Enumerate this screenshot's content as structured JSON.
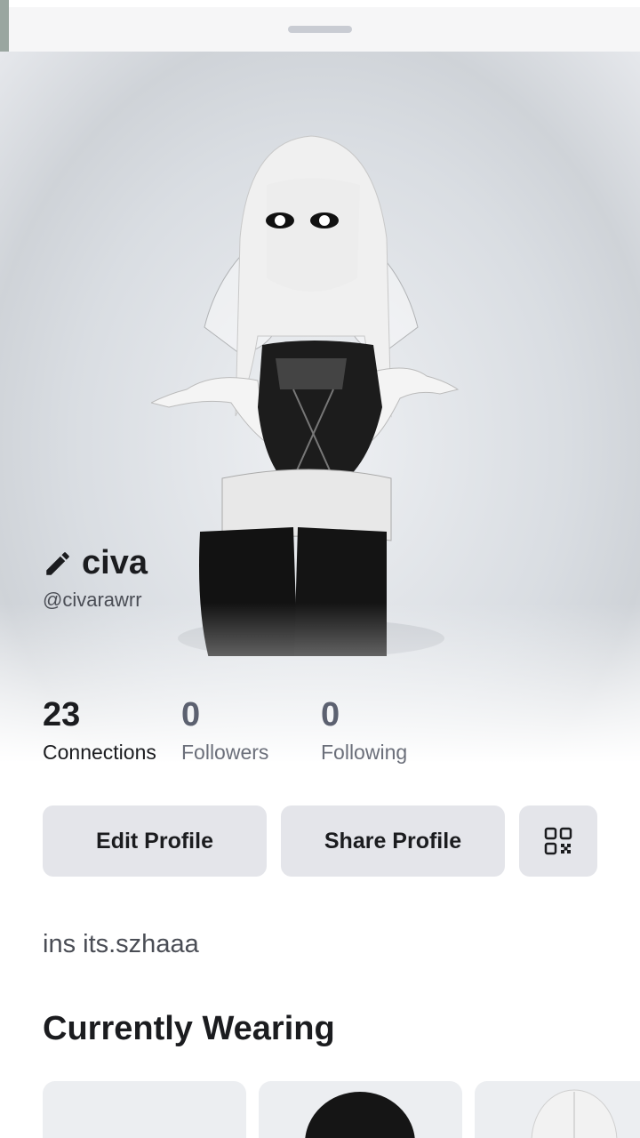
{
  "profile": {
    "display_name": "civa",
    "username": "@civarawrr",
    "bio": "ins its.szhaaa"
  },
  "stats": [
    {
      "value": "23",
      "label": "Connections"
    },
    {
      "value": "0",
      "label": "Followers"
    },
    {
      "value": "0",
      "label": "Following"
    }
  ],
  "actions": {
    "edit_profile": "Edit Profile",
    "share_profile": "Share Profile",
    "qr_icon": "qr-code-icon"
  },
  "sections": {
    "currently_wearing": "Currently Wearing"
  },
  "icons": {
    "edit": "pencil-icon"
  },
  "colors": {
    "button_bg": "#e4e5ea",
    "text_primary": "#1b1c1f",
    "text_secondary": "#5c6170"
  }
}
